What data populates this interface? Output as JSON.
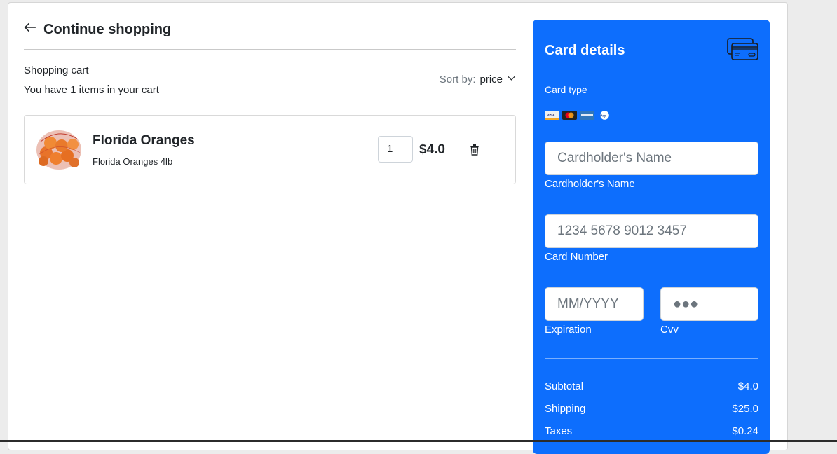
{
  "nav": {
    "continue_label": "Continue shopping"
  },
  "cart": {
    "title": "Shopping cart",
    "subtitle": "You have 1 items in your cart",
    "sort_prefix": "Sort by:",
    "sort_value": "price",
    "items": [
      {
        "name": "Florida Oranges",
        "description": "Florida Oranges 4lb",
        "quantity": "1",
        "price": "$4.0"
      }
    ]
  },
  "payment": {
    "title": "Card details",
    "card_type_label": "Card type",
    "brands": [
      "visa-icon",
      "mastercard-icon",
      "amex-icon",
      "paypal-icon"
    ],
    "name_placeholder": "Cardholder's Name",
    "name_label": "Cardholder's Name",
    "number_placeholder": "1234 5678 9012 3457",
    "number_label": "Card Number",
    "expiration_placeholder": "MM/YYYY",
    "expiration_label": "Expiration",
    "cvv_placeholder": "●●●",
    "cvv_label": "Cvv"
  },
  "summary": [
    {
      "label": "Subtotal",
      "value": "$4.0"
    },
    {
      "label": "Shipping",
      "value": "$25.0"
    },
    {
      "label": "Taxes",
      "value": "$0.24"
    }
  ],
  "colors": {
    "panel": "#0d6efd",
    "text": "#212529",
    "muted": "#6c757d"
  }
}
